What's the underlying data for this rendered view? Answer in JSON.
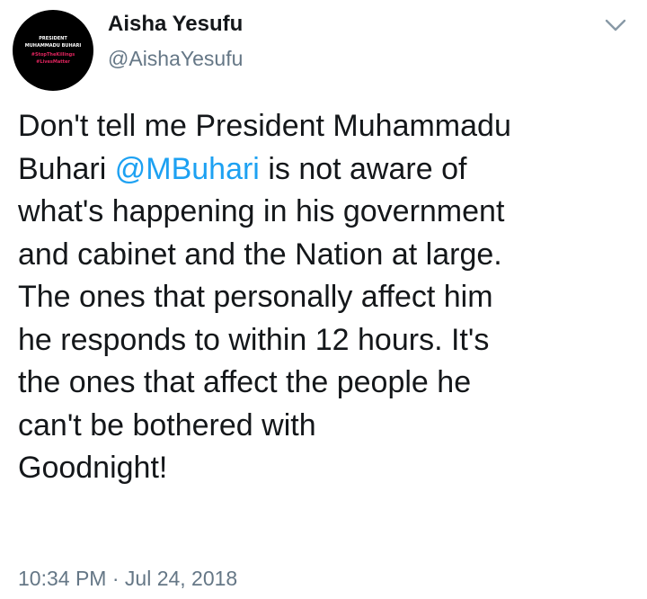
{
  "user": {
    "display_name": "Aisha Yesufu",
    "handle": "@AishaYesufu",
    "avatar_lines": [
      "PRESIDENT",
      "MUHAMMADU BUHARI",
      "#StopTheKillings",
      "#LivesMatter"
    ]
  },
  "menu": {
    "icon": "chevron-down-icon"
  },
  "tweet": {
    "lines": [
      "Don't tell me President Muhammadu",
      "Buhari",
      "is not aware of",
      "what's happening in his government",
      "and cabinet and the Nation at large.",
      "The ones that personally affect him",
      "he responds to within 12 hours. It's",
      "the ones that affect the people he",
      "can't be bothered with",
      "Goodnight!"
    ],
    "mention": "@MBuhari",
    "time": "10:34 PM",
    "separator": "·",
    "date": "Jul 24, 2018"
  },
  "colors": {
    "accent": "#1da1f2",
    "text": "#14171a",
    "muted": "#657786",
    "avatar_hashtag": "#e0245e"
  }
}
